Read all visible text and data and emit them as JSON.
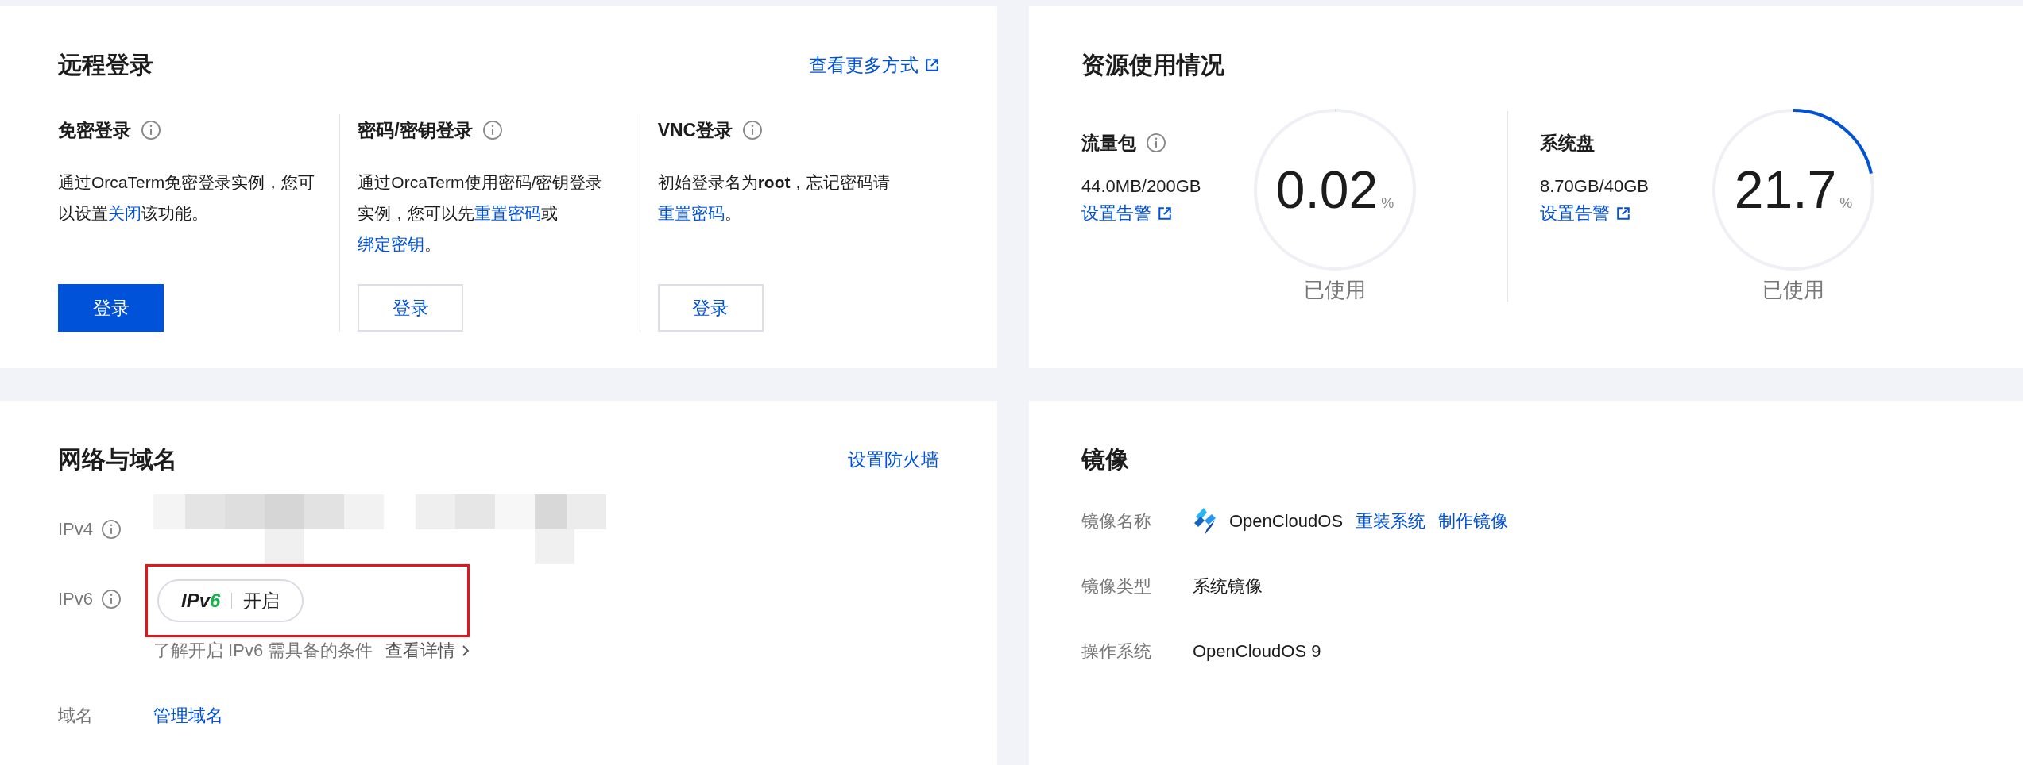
{
  "remote_login": {
    "title": "远程登录",
    "more_link": "查看更多方式",
    "methods": [
      {
        "title": "免密登录",
        "info": true,
        "description": [
          {
            "kind": "text",
            "text": "通过OrcaTerm免密登录实例，您可以设置"
          },
          {
            "kind": "link",
            "text": "关闭"
          },
          {
            "kind": "text",
            "text": "该功能。"
          }
        ],
        "button": {
          "label": "登录",
          "kind": "primary"
        }
      },
      {
        "title": "密码/密钥登录",
        "info": true,
        "description": [
          {
            "kind": "text",
            "text": "通过OrcaTerm使用密码/密钥登录实例，您可以先"
          },
          {
            "kind": "link",
            "text": "重置密码"
          },
          {
            "kind": "text",
            "text": "或"
          },
          {
            "kind": "link",
            "text": "绑定密钥"
          },
          {
            "kind": "text",
            "text": "。"
          }
        ],
        "button": {
          "label": "登录",
          "kind": "default"
        }
      },
      {
        "title": "VNC登录",
        "info": true,
        "description": [
          {
            "kind": "text",
            "text": "初始登录名为"
          },
          {
            "kind": "bold",
            "text": "root"
          },
          {
            "kind": "text",
            "text": "，忘记密码请"
          },
          {
            "kind": "link",
            "text": "重置密码"
          },
          {
            "kind": "text",
            "text": "。"
          }
        ],
        "button": {
          "label": "登录",
          "kind": "default"
        }
      }
    ]
  },
  "resource_usage": {
    "title": "资源使用情况",
    "items": [
      {
        "name": "流量包",
        "info": true,
        "usage": "44.0MB/200GB",
        "alert_link": "设置告警",
        "value": "0.02",
        "unit": "%",
        "caption": "已使用",
        "level": 0.0002
      },
      {
        "name": "系统盘",
        "info": false,
        "usage": "8.70GB/40GB",
        "alert_link": "设置告警",
        "value": "21.7",
        "unit": "%",
        "caption": "已使用",
        "level": 0.217
      }
    ]
  },
  "network": {
    "title": "网络与域名",
    "firewall_link": "设置防火墙",
    "rows": [
      {
        "kind": "masked",
        "label": "IPv4",
        "info": true
      },
      {
        "kind": "toggle",
        "label": "IPv6",
        "info": true,
        "badge": "IPv6",
        "action": "开启",
        "highlighted": true,
        "hint": "了解开启 IPv6 需具备的条件",
        "detail_link": "查看详情"
      },
      {
        "kind": "link",
        "label": "域名",
        "info": false,
        "link": "管理域名"
      }
    ]
  },
  "image": {
    "title": "镜像",
    "rows": [
      {
        "kind": "os",
        "label": "镜像名称",
        "value": "OpenCloudOS",
        "links": [
          "重装系统",
          "制作镜像"
        ]
      },
      {
        "kind": "text",
        "label": "镜像类型",
        "value": "系统镜像"
      },
      {
        "kind": "text",
        "label": "操作系统",
        "value": "OpenCloudOS 9"
      }
    ]
  }
}
